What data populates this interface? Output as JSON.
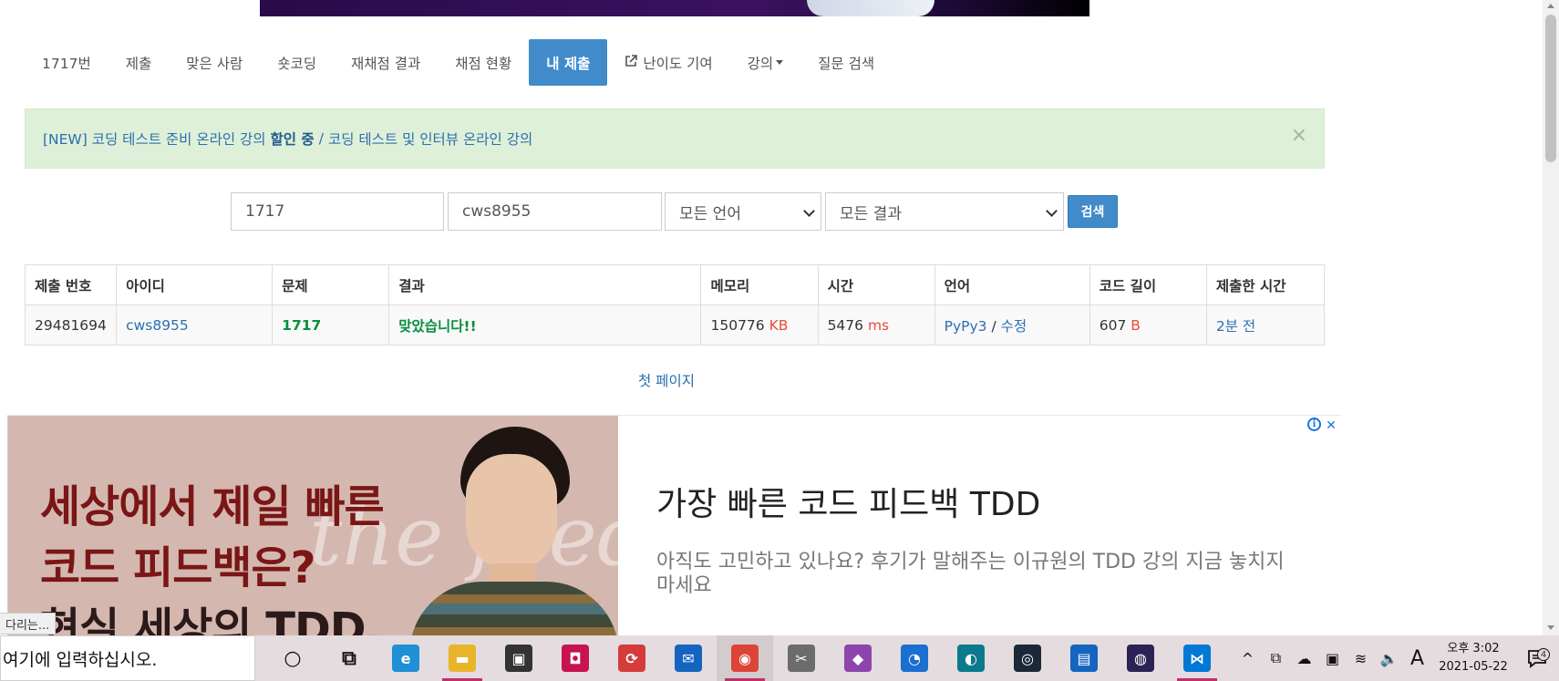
{
  "nav": {
    "items": [
      {
        "label": "1717번",
        "active": false
      },
      {
        "label": "제출",
        "active": false
      },
      {
        "label": "맞은 사람",
        "active": false
      },
      {
        "label": "숏코딩",
        "active": false
      },
      {
        "label": "재채점 결과",
        "active": false
      },
      {
        "label": "채점 현황",
        "active": false
      },
      {
        "label": "내 제출",
        "active": true
      },
      {
        "label": "난이도 기여",
        "active": false,
        "icon": "external-link-icon"
      },
      {
        "label": "강의",
        "active": false,
        "icon": "caret-down-icon"
      },
      {
        "label": "질문 검색",
        "active": false
      }
    ]
  },
  "alert": {
    "part1": "[NEW] 코딩 테스트 준비 온라인 강의",
    "part1_bold": "할인 중",
    "separator": "/",
    "part2": "코딩 테스트 및 인터뷰 온라인 강의",
    "close": "×"
  },
  "search": {
    "problem_id": "1717",
    "user_id": "cws8955",
    "language": "모든 언어",
    "result": "모든 결과",
    "button": "검색"
  },
  "table": {
    "headers": [
      "제출 번호",
      "아이디",
      "문제",
      "결과",
      "메모리",
      "시간",
      "언어",
      "코드 길이",
      "제출한 시간"
    ],
    "rows": [
      {
        "submission_id": "29481694",
        "user": "cws8955",
        "problem": "1717",
        "result": "맞았습니다!!",
        "memory": "150776",
        "memory_unit": "KB",
        "time": "5476",
        "time_unit": "ms",
        "language": "PyPy3",
        "lang_sep": "/",
        "edit": "수정",
        "code_length": "607",
        "code_unit": "B",
        "submitted": "2분 전"
      }
    ]
  },
  "pagination": {
    "first_page": "첫 페이지"
  },
  "ad": {
    "headline_1": "세상에서 제일 빠른",
    "headline_2": "코드 피드백은?",
    "headline_3": "현실 세상의 TDD.",
    "script_text": "the feed",
    "title": "가장 빠른 코드 피드백 TDD",
    "description": "아직도 고민하고 있나요? 후기가 말해주는 이규원의 TDD 강의 지금 놓치지 마세요",
    "info_icon": "i",
    "close_icon": "✕"
  },
  "status_bar": {
    "text": "다리는..."
  },
  "taskbar": {
    "search_placeholder": "여기에 입력하십시오.",
    "apps": [
      {
        "name": "cortana-icon",
        "color": "#111111",
        "glyph": "○",
        "running": false
      },
      {
        "name": "task-view-icon",
        "color": "#111111",
        "glyph": "⧉",
        "running": false
      },
      {
        "name": "edge-icon",
        "color": "#1f8fd6",
        "glyph": "e",
        "running": false
      },
      {
        "name": "file-explorer-icon",
        "color": "#e8b52a",
        "glyph": "▬",
        "running": true
      },
      {
        "name": "store-icon",
        "color": "#333333",
        "glyph": "▣",
        "running": false
      },
      {
        "name": "app-red-icon",
        "color": "#c8134f",
        "glyph": "◘",
        "running": false
      },
      {
        "name": "sync-app-icon",
        "color": "#d43c3c",
        "glyph": "⟳",
        "running": false
      },
      {
        "name": "mail-icon",
        "color": "#1565c0",
        "glyph": "✉",
        "running": false
      },
      {
        "name": "chrome-icon",
        "color": "#db4437",
        "glyph": "◉",
        "running": true,
        "active": true
      },
      {
        "name": "snip-tool-icon",
        "color": "#6b6b6b",
        "glyph": "✂",
        "running": false
      },
      {
        "name": "git-icon",
        "color": "#8e44ad",
        "glyph": "◆",
        "running": false
      },
      {
        "name": "app-blue-icon",
        "color": "#1a6fd0",
        "glyph": "◔",
        "running": false
      },
      {
        "name": "app-teal-icon",
        "color": "#0a7a8c",
        "glyph": "◐",
        "running": false
      },
      {
        "name": "steam-icon",
        "color": "#1b2838",
        "glyph": "◎",
        "running": false
      },
      {
        "name": "reader-icon",
        "color": "#1565c0",
        "glyph": "▤",
        "running": false
      },
      {
        "name": "eclipse-icon",
        "color": "#2c2255",
        "glyph": "◍",
        "running": false
      },
      {
        "name": "vscode-icon",
        "color": "#0078d4",
        "glyph": "⋈",
        "running": true
      }
    ],
    "tray": [
      "^",
      "⧉",
      "☁",
      "▣",
      "≋",
      "🔈",
      "A"
    ],
    "clock_time": "오후 3:02",
    "clock_date": "2021-05-22",
    "notification_count": "4"
  },
  "colors": {
    "primary": "#428bca",
    "alert_bg": "#dff0d8",
    "success": "#0b8e3e",
    "unit_red": "#e74c3c",
    "link": "#2a6fb0"
  }
}
